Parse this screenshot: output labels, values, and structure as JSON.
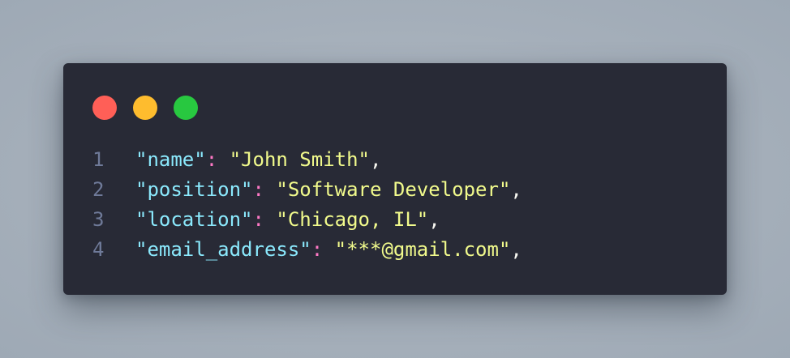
{
  "window": {
    "controls": [
      {
        "name": "close",
        "color": "#ff5f57"
      },
      {
        "name": "minimize",
        "color": "#febc2e"
      },
      {
        "name": "maximize",
        "color": "#28c840"
      }
    ]
  },
  "code": {
    "lines": [
      {
        "number": "1",
        "key": "\"name\"",
        "colon": ": ",
        "value": "\"John Smith\"",
        "comma": ","
      },
      {
        "number": "2",
        "key": "\"position\"",
        "colon": ": ",
        "value": "\"Software Developer\"",
        "comma": ","
      },
      {
        "number": "3",
        "key": "\"location\"",
        "colon": ": ",
        "value": "\"Chicago, IL\"",
        "comma": ","
      },
      {
        "number": "4",
        "key": "\"email_address\"",
        "colon": ": ",
        "value": "\"***@gmail.com\"",
        "comma": ","
      }
    ]
  },
  "colors": {
    "background": "#282a36",
    "line_number": "#6f7a99",
    "key": "#8be9fd",
    "colon": "#ff79c6",
    "string": "#f1fa8c",
    "punctuation": "#f8f8f2"
  }
}
